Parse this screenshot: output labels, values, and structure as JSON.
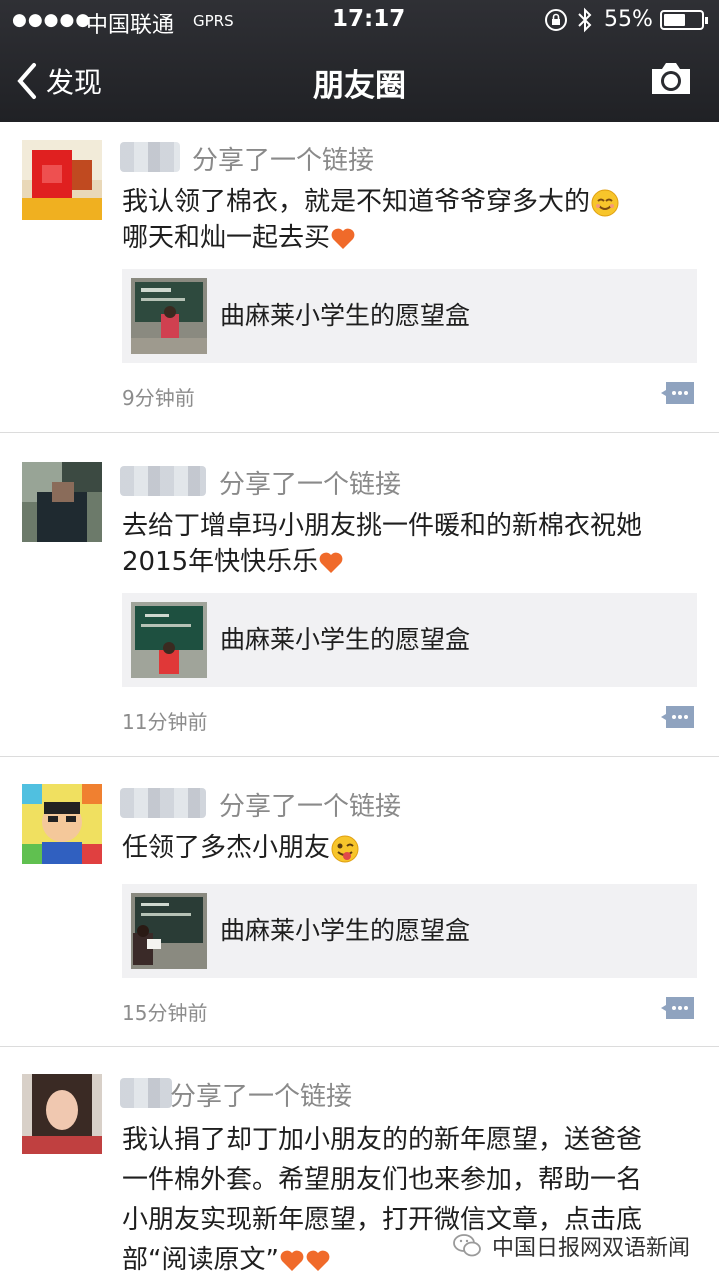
{
  "status_bar": {
    "signal": "●●●●●",
    "carrier": "中国联通",
    "network": "GPRS",
    "time": "17:17",
    "battery": "55%",
    "battery_level": 0.55
  },
  "nav": {
    "back_label": "发现",
    "title": "朋友圈"
  },
  "posts": [
    {
      "action": "分享了一个链接",
      "text": "我认领了棉衣，就是不知道爷爷穿多大的",
      "text2": "哪天和灿一起去买",
      "link_title": "曲麻莱小学生的愿望盒",
      "time": "9分钟前"
    },
    {
      "action": "分享了一个链接",
      "text": "去给丁增卓玛小朋友挑一件暖和的新棉衣祝她",
      "text2": "2015年快快乐乐",
      "link_title": "曲麻莱小学生的愿望盒",
      "time": "11分钟前"
    },
    {
      "action": "分享了一个链接",
      "text": "任领了多杰小朋友",
      "link_title": "曲麻莱小学生的愿望盒",
      "time": "15分钟前"
    },
    {
      "action": "分享了一个链接",
      "text": "我认捐了却丁加小朋友的的新年愿望，送爸爸",
      "text2": "一件棉外套。希望朋友们也来参加，帮助一名",
      "text3": "小朋友实现新年愿望，打开微信文章，点击底",
      "text4": "部“阅读原文”"
    }
  ],
  "watermark": "中国日报网双语新闻",
  "colors": {
    "nav_bg": "#2a2b30",
    "heart": "#f06a2a",
    "link_card_bg": "#f1f1f3",
    "muted_text": "#8a8a8a"
  }
}
